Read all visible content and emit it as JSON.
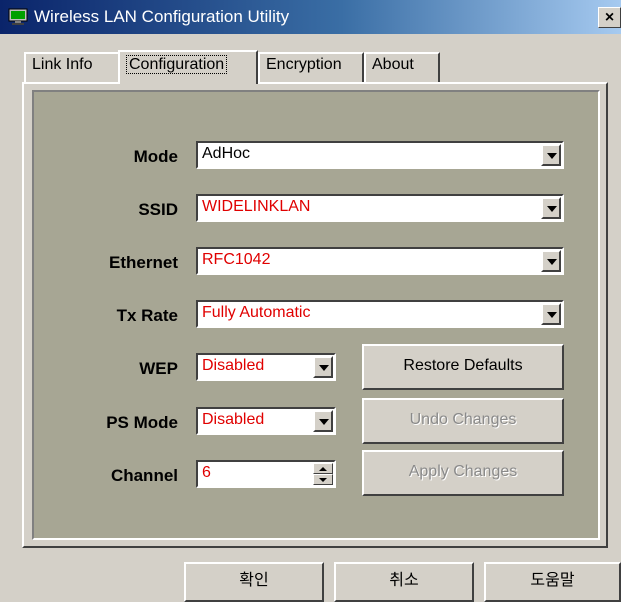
{
  "window": {
    "title": "Wireless LAN Configuration Utility",
    "close_glyph": "×",
    "icon": "network-monitor-icon"
  },
  "tabs": [
    {
      "label": "Link Info",
      "active": false
    },
    {
      "label": "Configuration",
      "active": true
    },
    {
      "label": "Encryption",
      "active": false
    },
    {
      "label": "About",
      "active": false
    }
  ],
  "config": {
    "mode": {
      "label": "Mode",
      "value": "AdHoc"
    },
    "ssid": {
      "label": "SSID",
      "value": "WIDELINKLAN"
    },
    "ethernet": {
      "label": "Ethernet",
      "value": "RFC1042"
    },
    "tx_rate": {
      "label": "Tx Rate",
      "value": "Fully Automatic"
    },
    "wep": {
      "label": "WEP",
      "value": "Disabled"
    },
    "ps_mode": {
      "label": "PS Mode",
      "value": "Disabled"
    },
    "channel": {
      "label": "Channel",
      "value": "6"
    }
  },
  "buttons": {
    "restore_defaults": "Restore Defaults",
    "undo_changes": "Undo Changes",
    "apply_changes": "Apply Changes"
  },
  "footer": {
    "ok": "확인",
    "cancel": "취소",
    "help": "도움말"
  },
  "colors": {
    "panel_bg": "#a7a694",
    "value_red": "#e00000",
    "title_start": "#0a246a"
  }
}
